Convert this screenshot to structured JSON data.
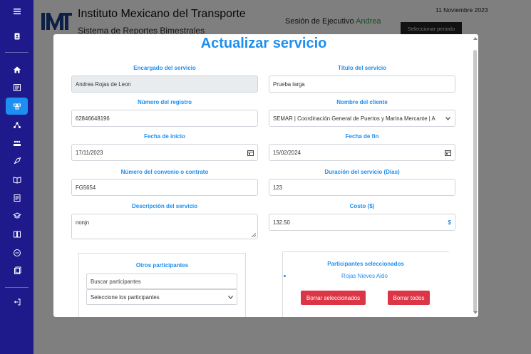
{
  "header": {
    "institute": "Instituto Mexicano del Transporte",
    "system": "Sistema de Reportes Bimestrales",
    "session_prefix": "Sesión de Ejecutivo ",
    "session_user": "Andrea",
    "date": "11 Noviembre 2023",
    "period_button": "Seleccionar periodo"
  },
  "sidebar": {
    "icons": [
      "menu-icon",
      "user-badge-icon",
      "home-icon",
      "report-icon",
      "services-icon",
      "network-icon",
      "team-icon",
      "rocket-icon",
      "book-icon",
      "document-icon",
      "graduation-icon",
      "bookstack-icon",
      "minus-circle-icon",
      "file-icon",
      "logout-icon"
    ],
    "active_index": 4
  },
  "modal": {
    "title": "Actualizar servicio",
    "fields": {
      "encargado": {
        "label": "Encargado del servicio",
        "value": "Andrea Rojas de Leon"
      },
      "titulo": {
        "label": "Título del servicio",
        "value": "Prueba larga"
      },
      "numero_registro": {
        "label": "Número del registro",
        "value": "62846648196"
      },
      "cliente": {
        "label": "Nombre del cliente",
        "value": "SEMAR | Coordinación General de Puertos y Marina Mercante | A"
      },
      "fecha_inicio": {
        "label": "Fecha de inicio",
        "value": "17/11/2023"
      },
      "fecha_fin": {
        "label": "Fecha de fin",
        "value": "15/02/2024"
      },
      "convenio": {
        "label": "Número del convenio o contrato",
        "value": "FG5654"
      },
      "duracion": {
        "label": "Duración del servicio (Días)",
        "value": "123"
      },
      "descripcion": {
        "label": "Descripción del servicio",
        "value": "nonjn"
      },
      "costo": {
        "label": "Costo ($)",
        "value": "132.50",
        "suffix": "$"
      }
    },
    "otros": {
      "title": "Otros participantes",
      "search_placeholder": "Buscar participantes",
      "select_value": "Seleccione los participantes"
    },
    "seleccionados": {
      "title": "Participantes seleccionados",
      "items": [
        "Rojas Nieves Aldo"
      ],
      "clear_selected": "Borrar seleccionados",
      "clear_all": "Borrar todos"
    }
  },
  "colors": {
    "sidebar": "#1f1a8c",
    "accent": "#1d8ff0",
    "danger": "#dc3545",
    "session_user": "#2e9e4a"
  }
}
